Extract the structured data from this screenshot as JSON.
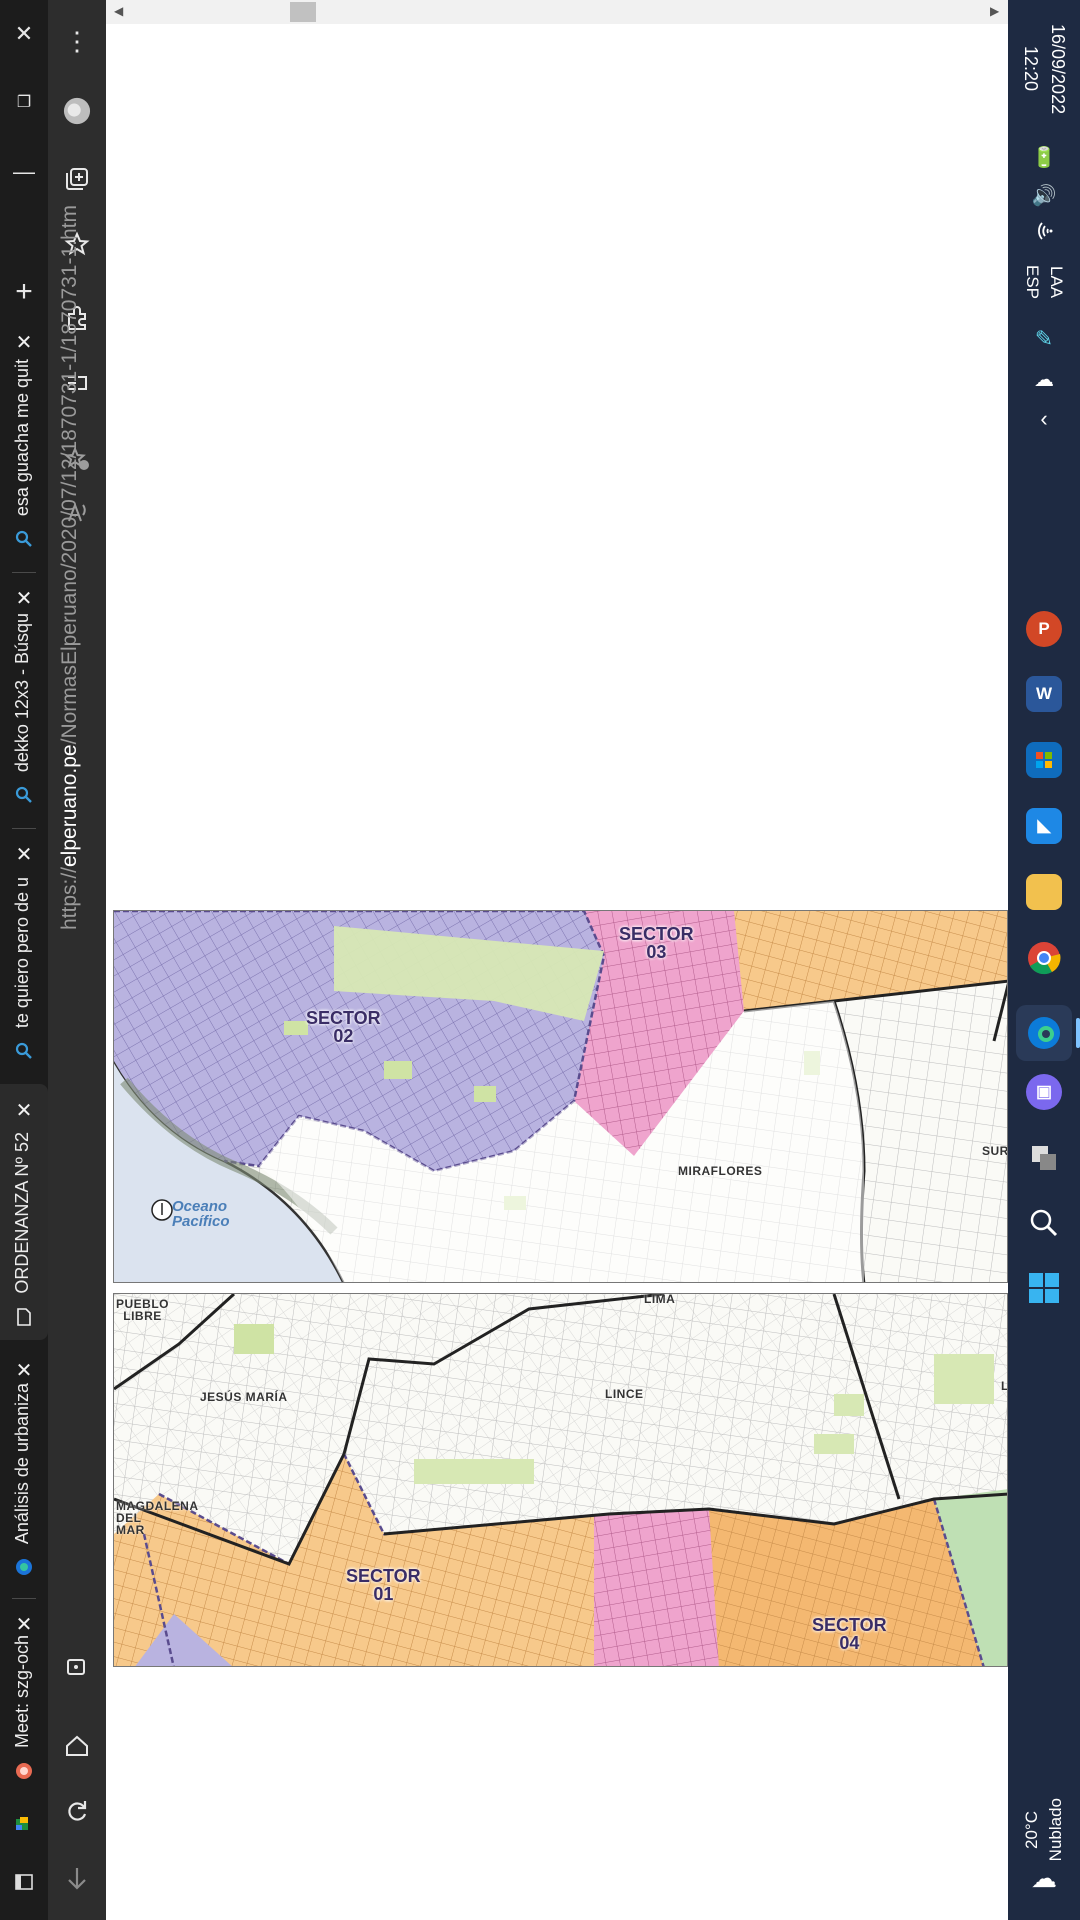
{
  "tabs": [
    {
      "label": "te quiero pero de u",
      "favicon": "search-icon",
      "active": false
    },
    {
      "label": "dekko 12x3 - Búsqu",
      "favicon": "search-icon",
      "active": false
    },
    {
      "label": "esa guacha me quit",
      "favicon": "search-icon",
      "active": false
    },
    {
      "label": "ORDENANZA Nº 52",
      "favicon": "document-icon",
      "active": true
    },
    {
      "label": "Análisis de urbaniza",
      "favicon": "edge-copilot-icon",
      "active": false
    },
    {
      "label": "Meet: szg-och",
      "favicon": "meet-icon",
      "active": false
    }
  ],
  "url": {
    "prefix": "https://",
    "domain": "elperuano.pe",
    "path": "/NormasElperuano/2020/07/12/1870731-1/1870731-1.htm"
  },
  "map_upper": {
    "sectors": [
      {
        "label": "SECTOR\n02"
      },
      {
        "label": "SECTOR\n03"
      }
    ],
    "districts": [
      "MIRAFLORES",
      "SUR"
    ],
    "ocean": "Oceano\nPacífico"
  },
  "map_lower": {
    "sectors": [
      {
        "label": "SECTOR\n01"
      },
      {
        "label": "SECTOR\n04"
      }
    ],
    "districts": [
      "PUEBLO\nLIBRE",
      "LIMA",
      "JESÚS MARÍA",
      "LINCE",
      "MAGDALENA\nDEL\nMAR",
      "L"
    ]
  },
  "taskbar": {
    "time": "12:20",
    "date": "16/09/2022",
    "lang": "ESP",
    "layout": "LAA",
    "weather_temp": "20°C",
    "weather_desc": "Nublado",
    "apps": [
      "powerpoint-icon",
      "word-icon",
      "store-icon",
      "app-icon",
      "files-icon",
      "chrome-icon",
      "edge-icon",
      "teams-icon",
      "taskview-icon",
      "search-icon",
      "start-icon"
    ]
  },
  "colors": {
    "sector_purple": "#b9b3e0",
    "sector_pink": "#efa4cd",
    "sector_orange": "#f7c98b",
    "park_green": "#d7e8b4",
    "sea_blue": "#dde5f0",
    "taskbar_bg": "#1e2a42"
  }
}
